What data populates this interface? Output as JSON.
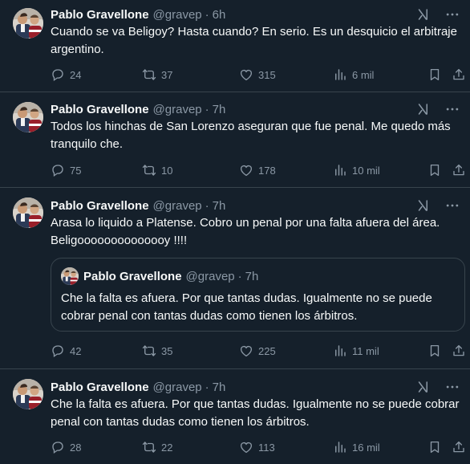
{
  "tweets": [
    {
      "name": "Pablo Gravellone",
      "handle": "@gravep",
      "separator": "·",
      "time": "6h",
      "text": "Cuando se va Beligoy? Hasta cuando? En serio. Es un desquicio el arbitraje argentino.",
      "replies": "24",
      "retweets": "37",
      "likes": "315",
      "views": "6 mil"
    },
    {
      "name": "Pablo Gravellone",
      "handle": "@gravep",
      "separator": "·",
      "time": "7h",
      "text": "Todos los hinchas de San Lorenzo aseguran que fue penal. Me quedo más tranquilo che.",
      "replies": "75",
      "retweets": "10",
      "likes": "178",
      "views": "10 mil"
    },
    {
      "name": "Pablo Gravellone",
      "handle": "@gravep",
      "separator": "·",
      "time": "7h",
      "text": "Arasa lo liquido a Platense. Cobro un penal por una falta afuera del área. Beligoooooooooooooy !!!!",
      "quote": {
        "name": "Pablo Gravellone",
        "handle": "@gravep",
        "separator": "·",
        "time": "7h",
        "text": "Che la falta es afuera. Por que tantas dudas. Igualmente no se puede cobrar penal con tantas dudas como tienen los árbitros."
      },
      "replies": "42",
      "retweets": "35",
      "likes": "225",
      "views": "11 mil"
    },
    {
      "name": "Pablo Gravellone",
      "handle": "@gravep",
      "separator": "·",
      "time": "7h",
      "text": "Che la falta es afuera. Por que tantas dudas. Igualmente no se puede cobrar penal con tantas dudas como tienen los árbitros.",
      "replies": "28",
      "retweets": "22",
      "likes": "113",
      "views": "16 mil"
    }
  ],
  "icons": {
    "reply": "reply-icon",
    "retweet": "retweet-icon",
    "like": "like-icon",
    "views": "views-icon",
    "bookmark": "bookmark-icon",
    "share": "share-icon",
    "grok": "grok-icon",
    "more": "more-icon"
  },
  "colors": {
    "background": "#15202b",
    "text": "#f7f9f9",
    "secondary": "#8b98a5",
    "border": "#38444d"
  }
}
